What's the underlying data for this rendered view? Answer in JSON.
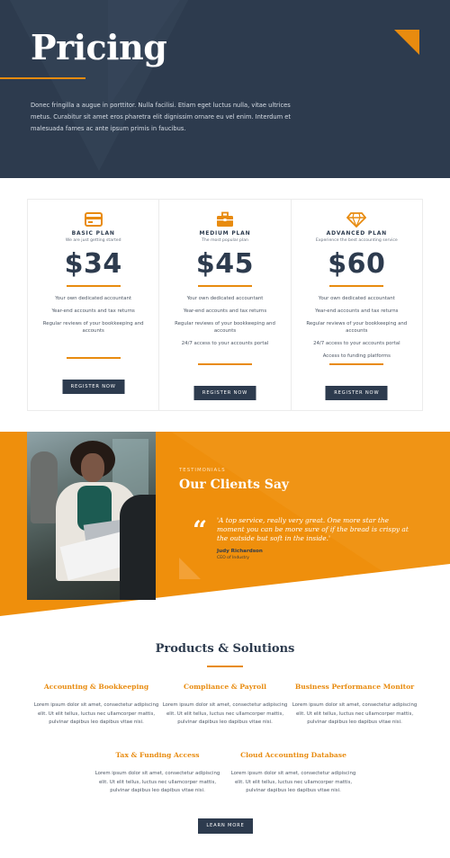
{
  "hero": {
    "title": "Pricing",
    "text": "Donec fringilla a augue in porttitor. Nulla facilisi. Etiam eget luctus nulla, vitae ultrices metus. Curabitur sit amet eros pharetra elit dignissim ornare eu vel enim. Interdum et malesuada fames ac ante ipsum primis in faucibus."
  },
  "plans": [
    {
      "icon": "credit-card-icon",
      "name": "BASIC PLAN",
      "subtitle": "We are just getting started",
      "price": "$34",
      "features": [
        "Your own dedicated accountant",
        "Year-end accounts and tax returns",
        "Regular reviews of your bookkeeping and accounts"
      ],
      "button": "REGISTER NOW"
    },
    {
      "icon": "briefcase-icon",
      "name": "MEDIUM PLAN",
      "subtitle": "The most popular plan",
      "price": "$45",
      "features": [
        "Your own dedicated accountant",
        "Year-end accounts and tax returns",
        "Regular reviews of your bookkeeping and accounts",
        "24/7 access to your accounts portal"
      ],
      "button": "REGISTER NOW"
    },
    {
      "icon": "diamond-icon",
      "name": "ADVANCED PLAN",
      "subtitle": "Experience the best accounting service",
      "price": "$60",
      "features": [
        "Your own dedicated accountant",
        "Year-end accounts and tax returns",
        "Regular reviews of your bookkeeping and accounts",
        "24/7 access to your accounts portal",
        "Access to funding platforms"
      ],
      "button": "REGISTER NOW"
    }
  ],
  "testimonials": {
    "eyebrow": "TESTIMONIALS",
    "title": "Our Clients Say",
    "quote_mark": "“",
    "quote": "'A top service, really very great. One more star the moment you can be more sure of if the bread is crispy at the outside but soft in the inside.'",
    "author": "Judy Richardson",
    "role": "CEO of Industry"
  },
  "products": {
    "title": "Products & Solutions",
    "items": [
      {
        "title": "Accounting & Bookkeeping",
        "text": "Lorem ipsum dolor sit amet, consectetur adipiscing elit. Ut elit tellus, luctus nec ullamcorper mattis, pulvinar dapibus leo dapibus vitae nisi."
      },
      {
        "title": "Compliance & Payroll",
        "text": "Lorem ipsum dolor sit amet, consectetur adipiscing elit. Ut elit tellus, luctus nec ullamcorper mattis, pulvinar dapibus leo dapibus vitae nisi."
      },
      {
        "title": "Business Performance Monitor",
        "text": "Lorem ipsum dolor sit amet, consectetur adipiscing elit. Ut elit tellus, luctus nec ullamcorper mattis, pulvinar dapibus leo dapibus vitae nisi."
      },
      {
        "title": "Tax & Funding Access",
        "text": "Lorem ipsum dolor sit amet, consectetur adipiscing elit. Ut elit tellus, luctus nec ullamcorper mattis, pulvinar dapibus leo dapibus vitae nisi."
      },
      {
        "title": "Cloud Accounting Database",
        "text": "Lorem ipsum dolor sit amet, consectetur adipiscing elit. Ut elit tellus, luctus nec ullamcorper mattis, pulvinar dapibus leo dapibus vitae nisi."
      }
    ],
    "button": "LEARN MORE"
  },
  "colors": {
    "navy": "#2d3b4e",
    "orange": "#e88b0f"
  }
}
